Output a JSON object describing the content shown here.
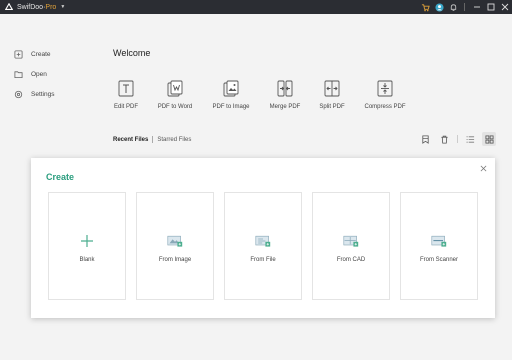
{
  "app": {
    "title": "SwifDoo",
    "edition": "Pro"
  },
  "sidebar": {
    "items": [
      {
        "label": "Create",
        "icon": "create-icon"
      },
      {
        "label": "Open",
        "icon": "folder-icon"
      },
      {
        "label": "Settings",
        "icon": "gear-icon"
      }
    ]
  },
  "main": {
    "welcome": "Welcome",
    "tools": [
      {
        "label": "Edit PDF",
        "icon": "edit-pdf-icon"
      },
      {
        "label": "PDF to Word",
        "icon": "pdf-to-word-icon"
      },
      {
        "label": "PDF to Image",
        "icon": "pdf-to-image-icon"
      },
      {
        "label": "Merge PDF",
        "icon": "merge-pdf-icon"
      },
      {
        "label": "Split PDF",
        "icon": "split-pdf-icon"
      },
      {
        "label": "Compress PDF",
        "icon": "compress-pdf-icon"
      }
    ],
    "file_tabs": {
      "active": "Recent Files",
      "other": "Starred Files"
    },
    "view_mode": "grid"
  },
  "create_panel": {
    "title": "Create",
    "cards": [
      {
        "label": "Blank",
        "icon": "plus-icon"
      },
      {
        "label": "From Image",
        "icon": "image-icon"
      },
      {
        "label": "From File",
        "icon": "file-icon"
      },
      {
        "label": "From CAD",
        "icon": "cad-icon"
      },
      {
        "label": "From Scanner",
        "icon": "scanner-icon"
      }
    ]
  },
  "colors": {
    "accent": "#2a9d7e",
    "titlebar": "#2b2d33",
    "pro": "#e0a23a"
  }
}
